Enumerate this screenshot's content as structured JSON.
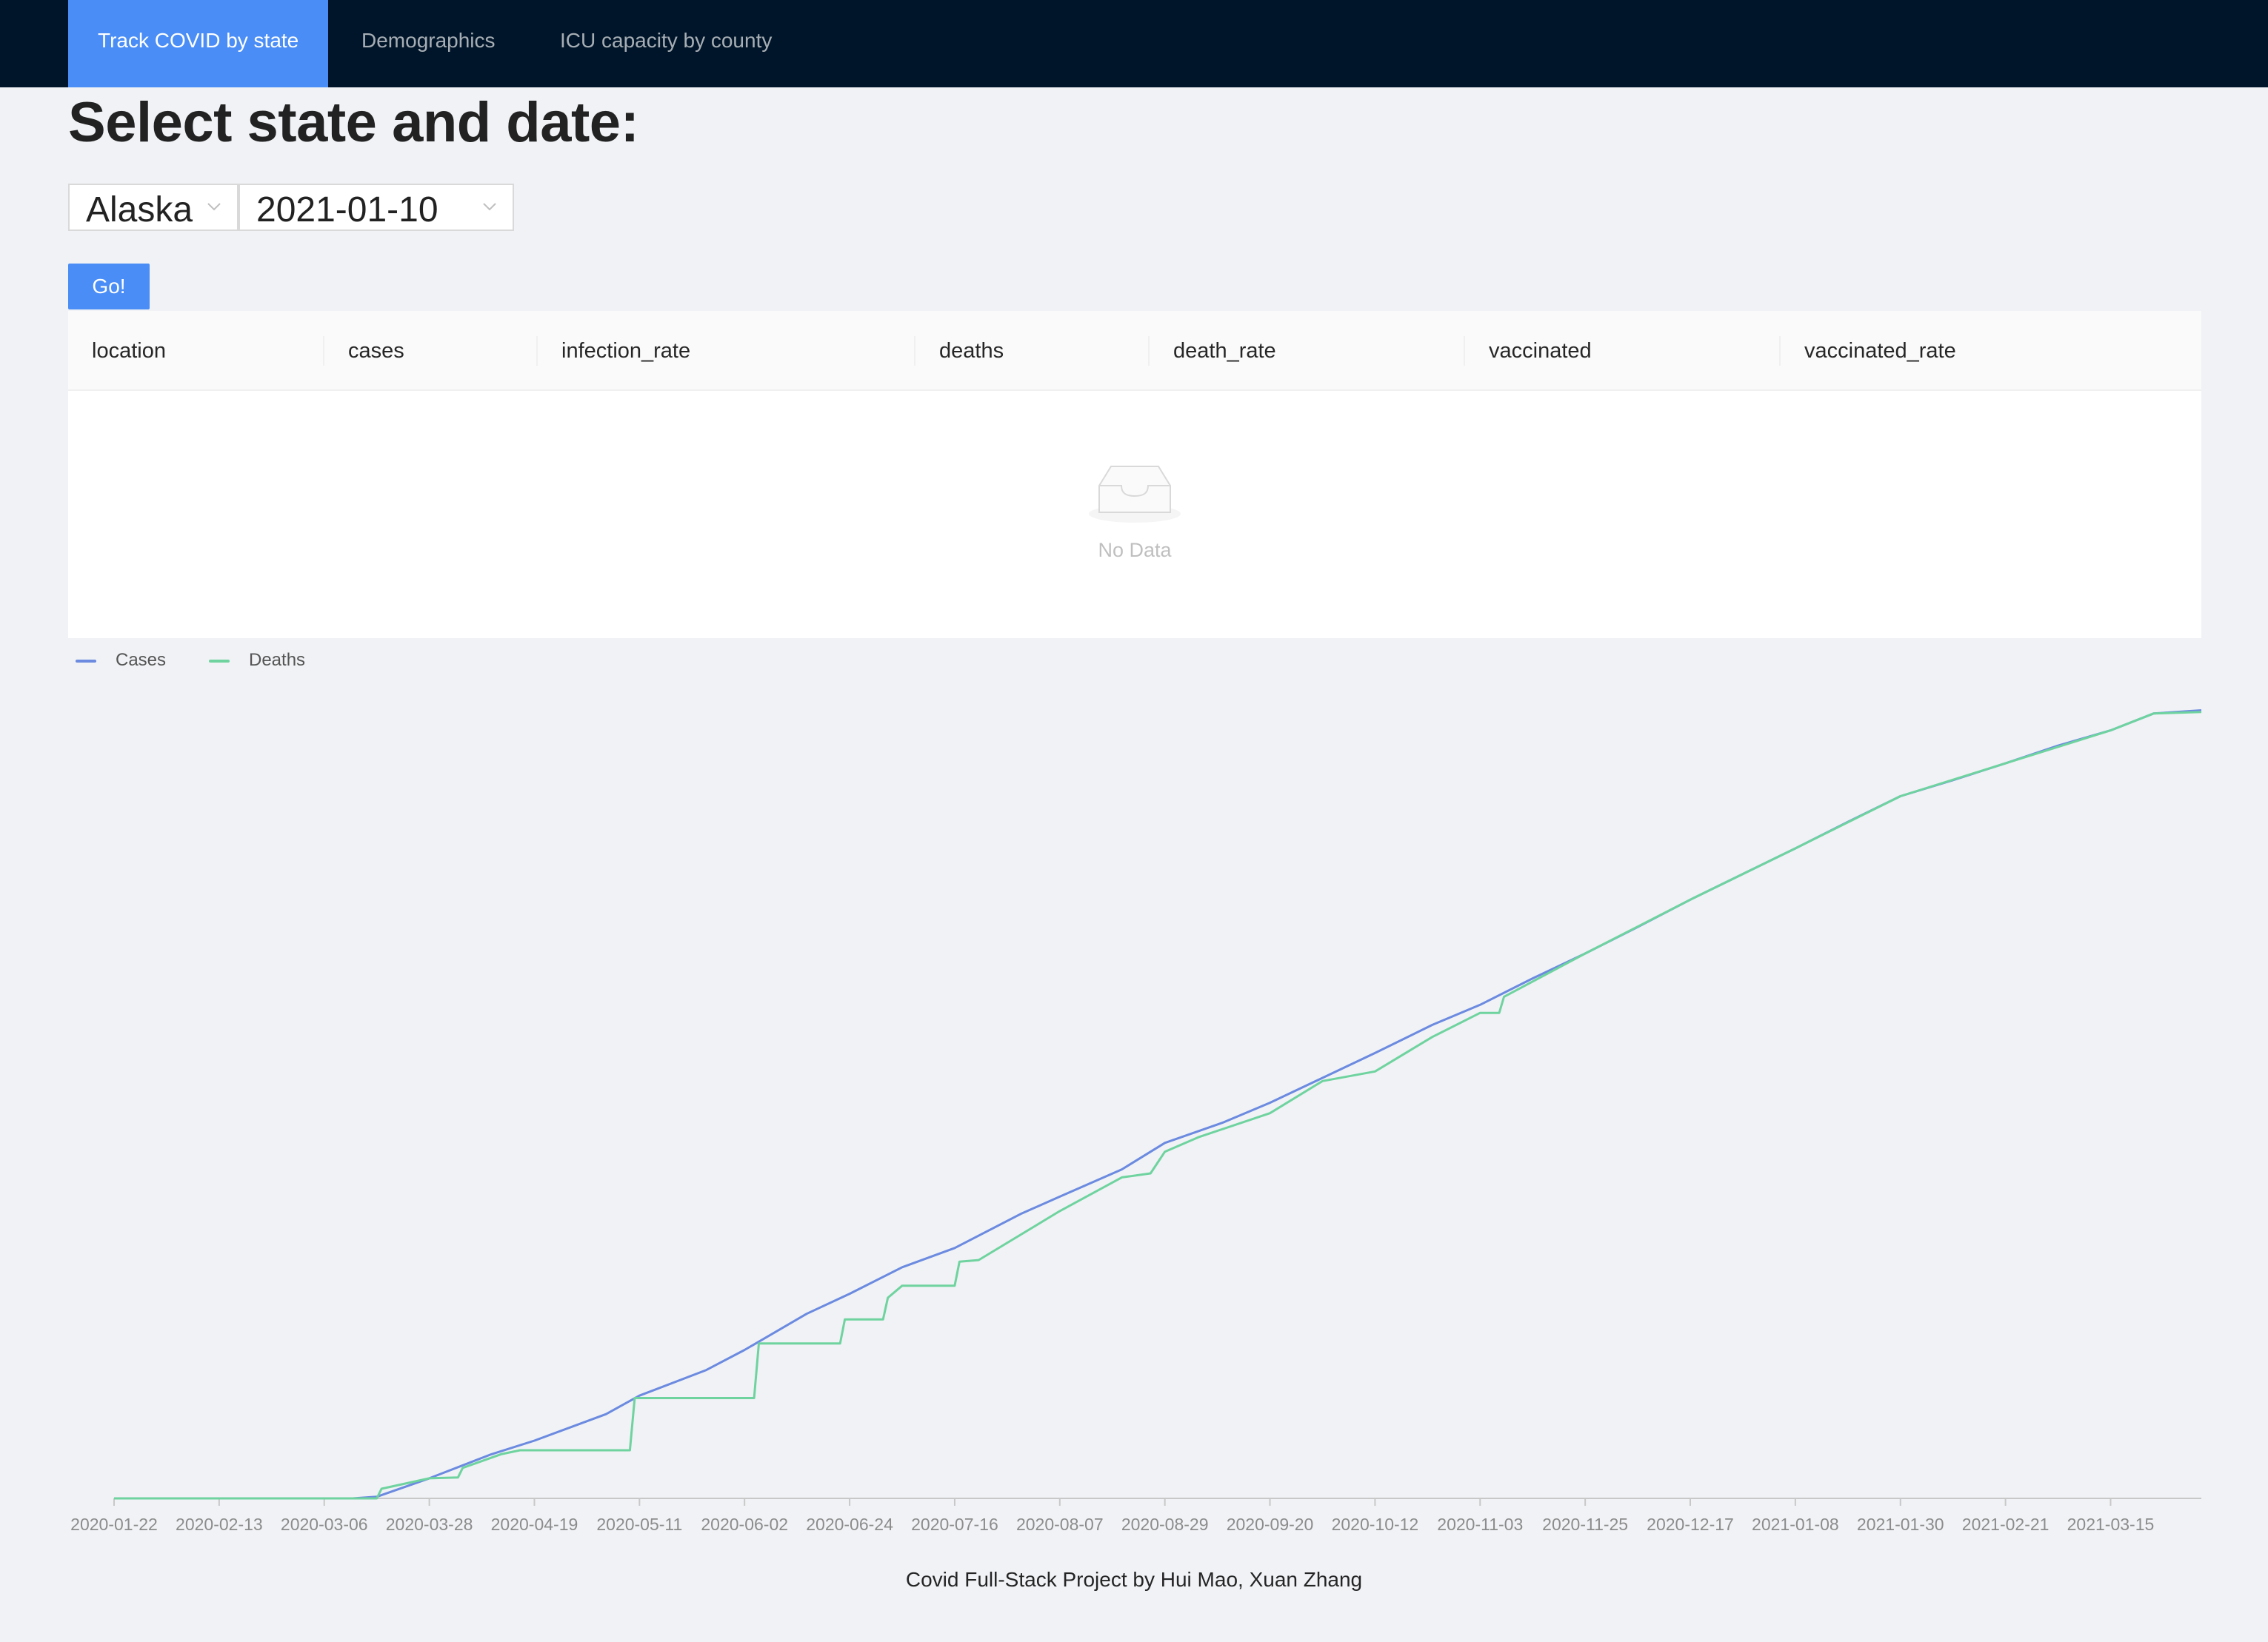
{
  "nav": {
    "items": [
      {
        "label": "Track COVID by state",
        "active": true
      },
      {
        "label": "Demographics",
        "active": false
      },
      {
        "label": "ICU capacity by county",
        "active": false
      }
    ]
  },
  "page_title": "Select state and date:",
  "state_select": {
    "value": "Alaska"
  },
  "date_select": {
    "value": "2021-01-10"
  },
  "go_button": {
    "label": "Go!"
  },
  "table": {
    "columns": [
      "location",
      "cases",
      "infection_rate",
      "deaths",
      "death_rate",
      "vaccinated",
      "vaccinated_rate"
    ],
    "rows": [],
    "empty_text": "No Data"
  },
  "footer": {
    "text": "Covid Full-Stack Project by Hui Mao, Xuan Zhang"
  },
  "colors": {
    "nav_bg": "#001529",
    "accent": "#4a8df6",
    "cases": "#6b8ae0",
    "deaths": "#6fd39f"
  },
  "chart_data": {
    "type": "line",
    "title": "",
    "xlabel": "",
    "ylabel": "",
    "legend_position": "top-left",
    "y_axis_visible": false,
    "grid": false,
    "x_tick_labels": [
      "2020-01-22",
      "2020-02-13",
      "2020-03-06",
      "2020-03-28",
      "2020-04-19",
      "2020-05-11",
      "2020-06-02",
      "2020-06-24",
      "2020-07-16",
      "2020-08-07",
      "2020-08-29",
      "2020-09-20",
      "2020-10-12",
      "2020-11-03",
      "2020-11-25",
      "2020-12-17",
      "2021-01-08",
      "2021-01-30",
      "2021-02-21",
      "2021-03-15"
    ],
    "x_range": [
      "2020-01-22",
      "2021-04-03"
    ],
    "series": [
      {
        "name": "Cases",
        "color": "#6b8ae0",
        "points": [
          [
            "2020-01-22",
            0
          ],
          [
            "2020-03-12",
            0
          ],
          [
            "2020-03-17",
            0.2
          ],
          [
            "2020-03-28",
            2.5
          ],
          [
            "2020-04-10",
            5.5
          ],
          [
            "2020-04-19",
            7.2
          ],
          [
            "2020-05-04",
            10.5
          ],
          [
            "2020-05-11",
            12.8
          ],
          [
            "2020-05-25",
            16.0
          ],
          [
            "2020-06-02",
            18.5
          ],
          [
            "2020-06-15",
            23.0
          ],
          [
            "2020-06-24",
            25.5
          ],
          [
            "2020-07-05",
            28.8
          ],
          [
            "2020-07-16",
            31.2
          ],
          [
            "2020-07-30",
            35.5
          ],
          [
            "2020-08-07",
            37.6
          ],
          [
            "2020-08-20",
            41.0
          ],
          [
            "2020-08-29",
            44.3
          ],
          [
            "2020-09-10",
            46.8
          ],
          [
            "2020-09-20",
            49.3
          ],
          [
            "2020-10-01",
            52.4
          ],
          [
            "2020-10-12",
            55.5
          ],
          [
            "2020-10-24",
            59.0
          ],
          [
            "2020-11-03",
            61.5
          ],
          [
            "2020-11-14",
            64.8
          ],
          [
            "2020-11-25",
            67.9
          ],
          [
            "2020-12-06",
            71.2
          ],
          [
            "2020-12-17",
            74.6
          ],
          [
            "2020-12-28",
            77.8
          ],
          [
            "2021-01-08",
            81.0
          ],
          [
            "2021-01-19",
            84.3
          ],
          [
            "2021-01-30",
            87.5
          ],
          [
            "2021-02-10",
            89.5
          ],
          [
            "2021-02-21",
            91.6
          ],
          [
            "2021-03-04",
            93.8
          ],
          [
            "2021-03-15",
            95.7
          ],
          [
            "2021-03-24",
            97.8
          ],
          [
            "2021-04-03",
            98.2
          ]
        ]
      },
      {
        "name": "Deaths",
        "color": "#6fd39f",
        "points": [
          [
            "2020-01-22",
            0
          ],
          [
            "2020-03-17",
            0
          ],
          [
            "2020-03-18",
            1.2
          ],
          [
            "2020-03-28",
            2.5
          ],
          [
            "2020-04-03",
            2.6
          ],
          [
            "2020-04-04",
            3.8
          ],
          [
            "2020-04-12",
            5.5
          ],
          [
            "2020-04-16",
            6.0
          ],
          [
            "2020-05-09",
            6.0
          ],
          [
            "2020-05-10",
            12.5
          ],
          [
            "2020-06-04",
            12.5
          ],
          [
            "2020-06-05",
            19.3
          ],
          [
            "2020-06-22",
            19.3
          ],
          [
            "2020-06-23",
            22.3
          ],
          [
            "2020-07-01",
            22.3
          ],
          [
            "2020-07-02",
            25.0
          ],
          [
            "2020-07-05",
            26.5
          ],
          [
            "2020-07-16",
            26.5
          ],
          [
            "2020-07-17",
            29.5
          ],
          [
            "2020-07-21",
            29.7
          ],
          [
            "2020-08-07",
            35.8
          ],
          [
            "2020-08-20",
            40.0
          ],
          [
            "2020-08-26",
            40.5
          ],
          [
            "2020-08-29",
            43.2
          ],
          [
            "2020-09-05",
            45.0
          ],
          [
            "2020-09-20",
            48.0
          ],
          [
            "2020-10-01",
            52.0
          ],
          [
            "2020-10-12",
            53.2
          ],
          [
            "2020-10-24",
            57.5
          ],
          [
            "2020-11-03",
            60.5
          ],
          [
            "2020-11-07",
            60.5
          ],
          [
            "2020-11-08",
            62.5
          ],
          [
            "2020-11-25",
            67.9
          ],
          [
            "2020-12-17",
            74.6
          ],
          [
            "2021-01-08",
            81.0
          ],
          [
            "2021-01-30",
            87.5
          ],
          [
            "2021-02-21",
            91.6
          ],
          [
            "2021-03-15",
            95.7
          ],
          [
            "2021-03-24",
            97.8
          ],
          [
            "2021-04-03",
            98.0
          ]
        ]
      }
    ]
  }
}
